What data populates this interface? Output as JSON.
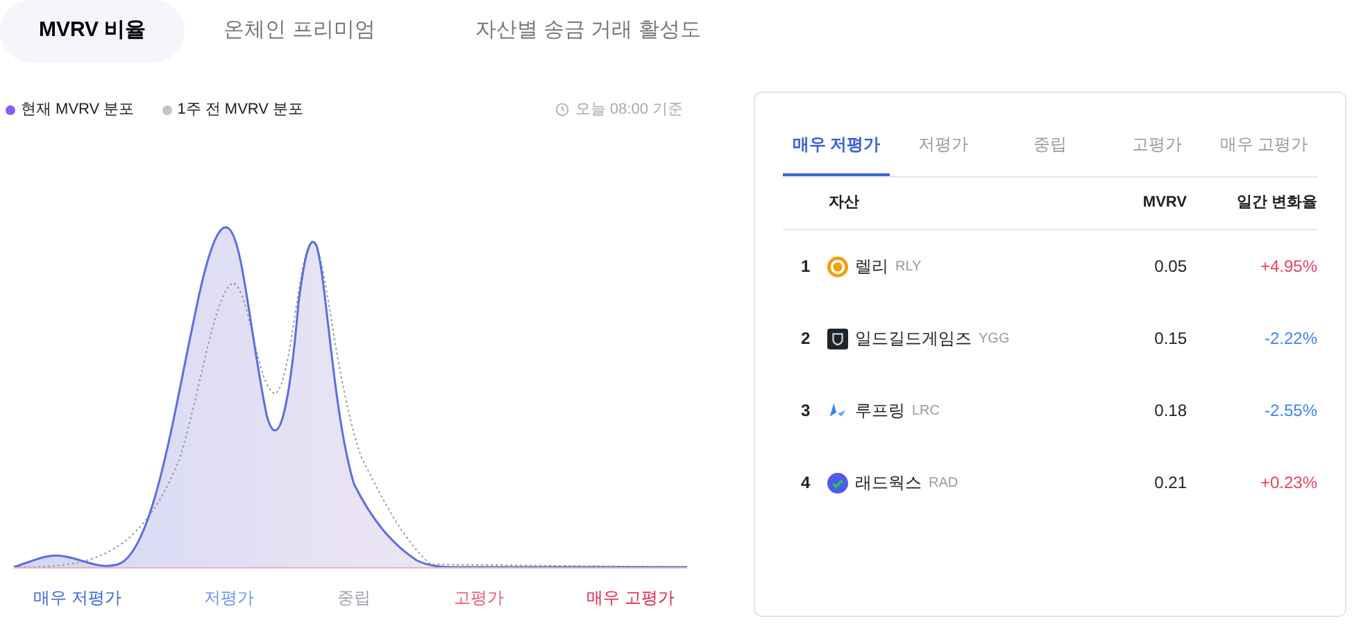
{
  "tabs": [
    {
      "label": "MVRV 비율",
      "selected": true
    },
    {
      "label": "온체인 프리미엄",
      "selected": false
    },
    {
      "label": "자산별 송금 거래 활성도",
      "selected": false
    }
  ],
  "legend": [
    {
      "label": "현재 MVRV 분포",
      "color": "#8b5cf6"
    },
    {
      "label": "1주 전 MVRV 분포",
      "color": "#c4c4c4"
    }
  ],
  "timestamp": "오늘 08:00 기준",
  "axis_labels": [
    {
      "label": "매우 저평가",
      "color": "#3b64d6"
    },
    {
      "label": "저평가",
      "color": "#6f95e6"
    },
    {
      "label": "중립",
      "color": "#9ca3af"
    },
    {
      "label": "고평가",
      "color": "#f0566f"
    },
    {
      "label": "매우 고평가",
      "color": "#e0244a"
    }
  ],
  "ranking": {
    "tabs": [
      {
        "label": "매우 저평가",
        "selected": true
      },
      {
        "label": "저평가",
        "selected": false
      },
      {
        "label": "중립",
        "selected": false
      },
      {
        "label": "고평가",
        "selected": false
      },
      {
        "label": "매우 고평가",
        "selected": false
      }
    ],
    "columns": [
      "자산",
      "MVRV",
      "일간 변화율"
    ],
    "rows": [
      {
        "rank": "1",
        "name": "렐리",
        "symbol": "RLY",
        "mvrv": "0.05",
        "change": "+4.95%",
        "kind": "up"
      },
      {
        "rank": "2",
        "name": "일드길드게임즈",
        "symbol": "YGG",
        "mvrv": "0.15",
        "change": "-2.22%",
        "kind": "down"
      },
      {
        "rank": "3",
        "name": "루프링",
        "symbol": "LRC",
        "mvrv": "0.18",
        "change": "-2.55%",
        "kind": "down"
      },
      {
        "rank": "4",
        "name": "래드웍스",
        "symbol": "RAD",
        "mvrv": "0.21",
        "change": "+0.23%",
        "kind": "up"
      }
    ]
  }
}
